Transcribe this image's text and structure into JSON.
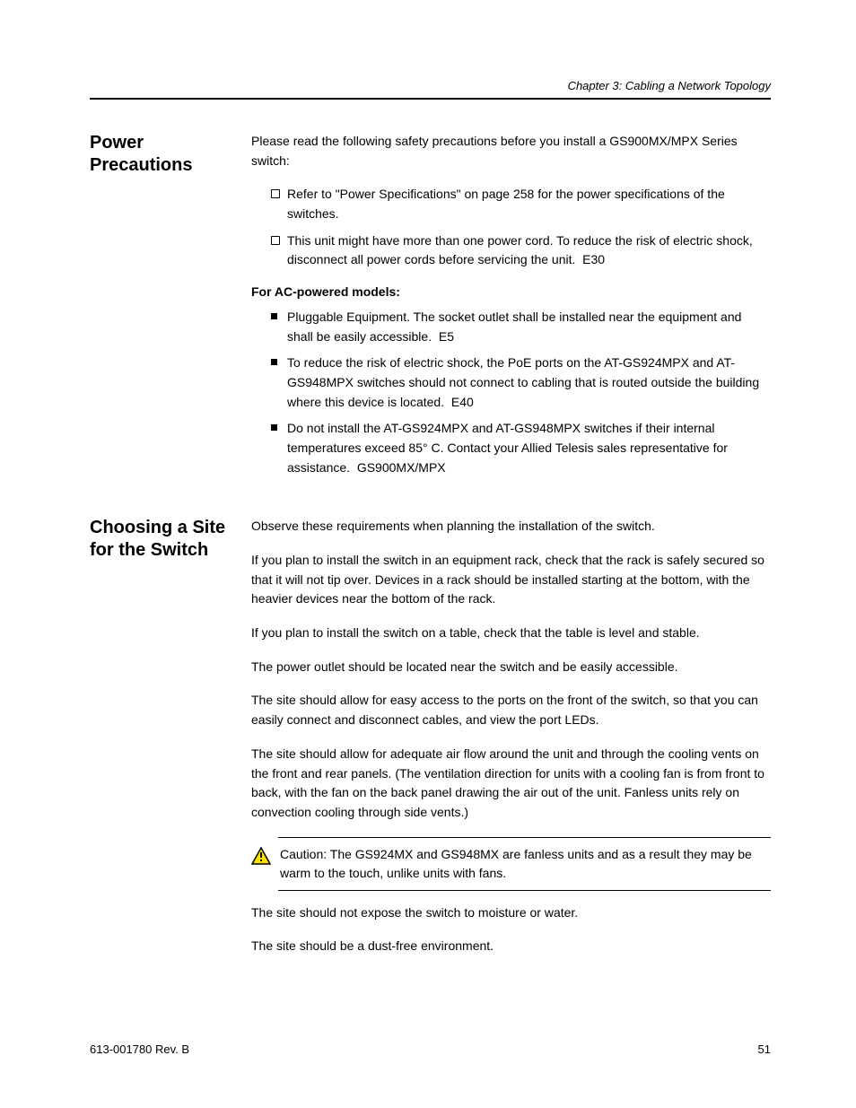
{
  "header": {
    "right": "Chapter 3: Cabling a Network Topology"
  },
  "section1": {
    "title": "Power Precautions",
    "intro": "Please read the following safety precautions before you install a GS900MX/MPX Series switch:",
    "open_items": [
      "Refer to \"Power Specifications\" on page 258 for the power specifications of the switches.",
      "This unit might have more than one power cord. To reduce the risk of electric shock, disconnect all power cords before servicing the unit."
    ],
    "e_suffix1": "  E30",
    "ac_label": "For AC-powered models:",
    "ac_items": [
      "Pluggable Equipment. The socket outlet shall be installed near the equipment and shall be easily accessible.",
      "To reduce the risk of electric shock, the PoE ports on the AT-GS924MPX and AT-GS948MPX switches should not connect to cabling that is routed outside the building where this device is located.",
      "Do not install the AT-GS924MPX and AT-GS948MPX switches if their internal temperatures exceed 85° C. Contact your Allied Telesis sales representative for assistance."
    ],
    "e_suffix2": "  E5",
    "e_suffix3": "  E40",
    "e_suffix4": "  GS900MX/MPX"
  },
  "section2": {
    "title": "Choosing a Site for the Switch",
    "p1": "Observe these requirements when planning the installation of the switch.",
    "p2": "If you plan to install the switch in an equipment rack, check that the rack is safely secured so that it will not tip over. Devices in a rack should be installed starting at the bottom, with the heavier devices near the bottom of the rack.",
    "p3": "If you plan to install the switch on a table, check that the table is level and stable.",
    "p4": "The power outlet should be located near the switch and be easily accessible.",
    "p5": "The site should allow for easy access to the ports on the front of the switch, so that you can easily connect and disconnect cables, and view the port LEDs.",
    "p6": "The site should allow for adequate air flow around the unit and through the cooling vents on the front and rear panels. (The ventilation direction for units with a cooling fan is from front to back, with the fan on the back panel drawing the air out of the unit. Fanless units rely on convection cooling through side vents.)",
    "caution": "Caution: The GS924MX and GS948MX are fanless units and as a result they may be warm to the touch, unlike units with fans.",
    "p7": "The site should not expose the switch to moisture or water.",
    "p8": "The site should be a dust-free environment."
  },
  "footer": {
    "left": "613-001780 Rev. B",
    "right": "51"
  }
}
